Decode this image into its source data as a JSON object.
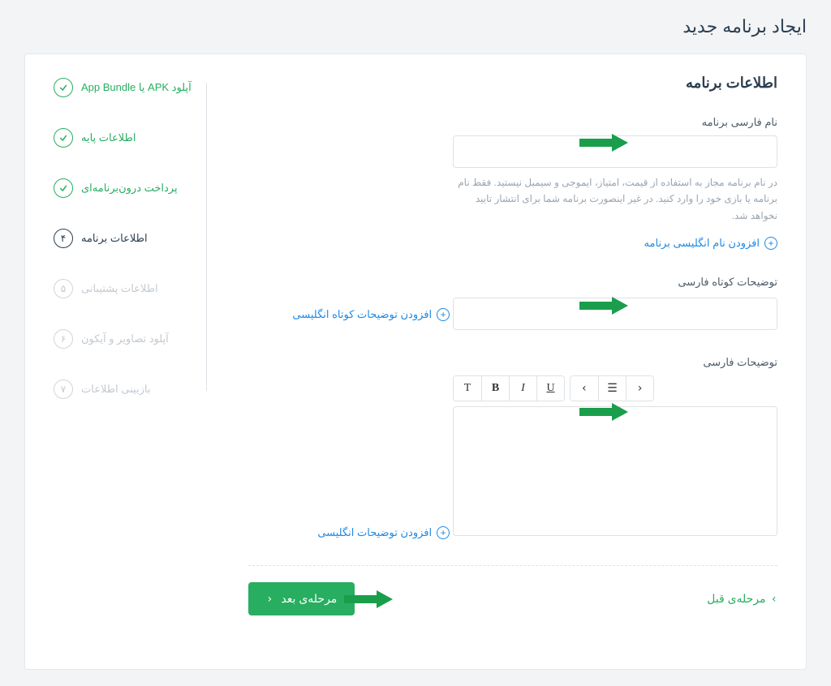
{
  "page_title": "ایجاد برنامه جدید",
  "section_title": "اطلاعات برنامه",
  "fields": {
    "fa_name": {
      "label": "نام فارسی برنامه",
      "helper": "در نام برنامه مجاز به استفاده از قیمت، امتیاز، ایموجی و سیمبل نیستید. فقط نام برنامه یا بازی خود را وارد کنید. در غیر اینصورت برنامه شما برای انتشار تایید نخواهد شد.",
      "add_link": "افزودن نام انگلیسی برنامه"
    },
    "short_desc": {
      "label": "توضیحات کوتاه فارسی",
      "add_link": "افزودن توضیحات کوتاه انگلیسی"
    },
    "long_desc": {
      "label": "توضیحات فارسی",
      "add_link": "افزودن توضیحات انگلیسی"
    }
  },
  "nav": {
    "prev": "مرحله‌ی قبل",
    "next": "مرحله‌ی بعد"
  },
  "steps": [
    {
      "label": "آپلود APK یا App Bundle",
      "state": "done",
      "num": ""
    },
    {
      "label": "اطلاعات پایه",
      "state": "done",
      "num": ""
    },
    {
      "label": "پرداخت درون‌برنامه‌ای",
      "state": "done",
      "num": ""
    },
    {
      "label": "اطلاعات برنامه",
      "state": "active",
      "num": "۴"
    },
    {
      "label": "اطلاعات پشتیبانی",
      "state": "pending",
      "num": "۵"
    },
    {
      "label": "آپلود تصاویر و آیکون",
      "state": "pending",
      "num": "۶"
    },
    {
      "label": "بازبینی اطلاعات",
      "state": "pending",
      "num": "۷"
    }
  ],
  "colors": {
    "accent_green": "#27ae60",
    "link_blue": "#1e88e5"
  }
}
